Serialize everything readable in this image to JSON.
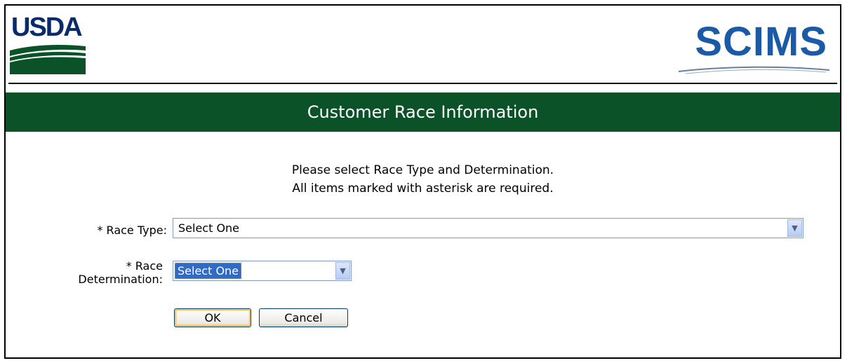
{
  "header": {
    "left_logo": "USDA",
    "right_logo": "SCIMS"
  },
  "title": "Customer Race Information",
  "instructions": {
    "line1": "Please select Race Type and Determination.",
    "line2": "All items marked with asterisk are required."
  },
  "form": {
    "race_type_label": "* Race Type:",
    "race_type_value": "Select One",
    "race_determination_label_line1": "* Race",
    "race_determination_label_line2": "Determination:",
    "race_determination_value": "Select One"
  },
  "buttons": {
    "ok": "OK",
    "cancel": "Cancel"
  },
  "colors": {
    "title_bar": "#0b5228",
    "usda_blue": "#0a2a6e",
    "scims_blue": "#1b5aa6",
    "selection": "#316ac5"
  }
}
